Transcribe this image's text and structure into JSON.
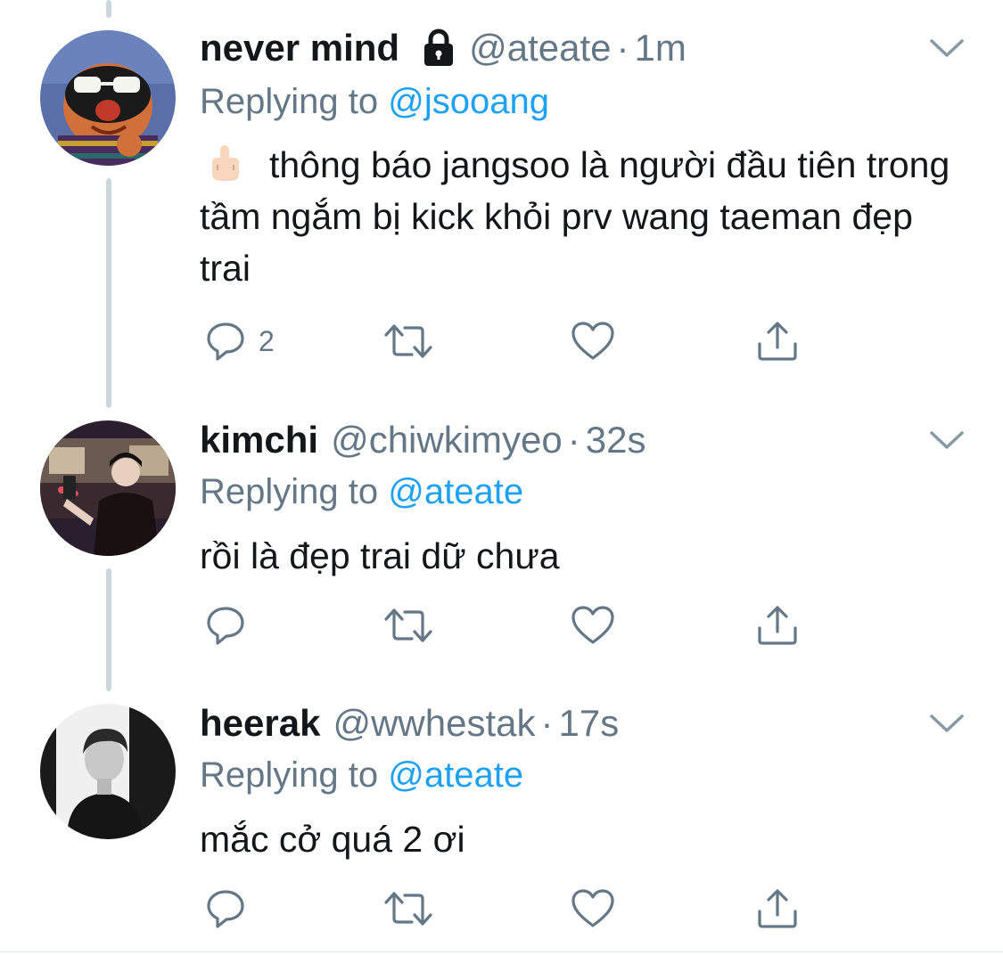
{
  "colors": {
    "text": "#14171a",
    "secondary": "#657786",
    "link": "#1da1f2",
    "thread_line": "#ccd6dd"
  },
  "tweets": [
    {
      "display_name": "never mind",
      "protected_icon": "lock-icon",
      "handle": "@ateate",
      "separator": "·",
      "time": "1m",
      "replying_prefix": "Replying to",
      "replying_handle": "@jsooang",
      "emoji": "middle-finger-emoji",
      "text": "thông báo jangsoo là người đầu tiên trong tầm ngắm bị kick khỏi prv wang taeman đẹp trai",
      "reply_count": "2"
    },
    {
      "display_name": "kimchi",
      "handle": "@chiwkimyeo",
      "separator": "·",
      "time": "32s",
      "replying_prefix": "Replying to",
      "replying_handle": "@ateate",
      "text": "rồi là đẹp trai dữ chưa",
      "reply_count": ""
    },
    {
      "display_name": "heerak",
      "handle": "@wwhestak",
      "separator": "·",
      "time": "17s",
      "replying_prefix": "Replying to",
      "replying_handle": "@ateate",
      "text": "mắc cở quá 2 ơi",
      "reply_count": ""
    }
  ],
  "icons": {
    "reply": "reply-icon",
    "retweet": "retweet-icon",
    "like": "heart-icon",
    "share": "share-icon",
    "more": "chevron-down-icon"
  }
}
